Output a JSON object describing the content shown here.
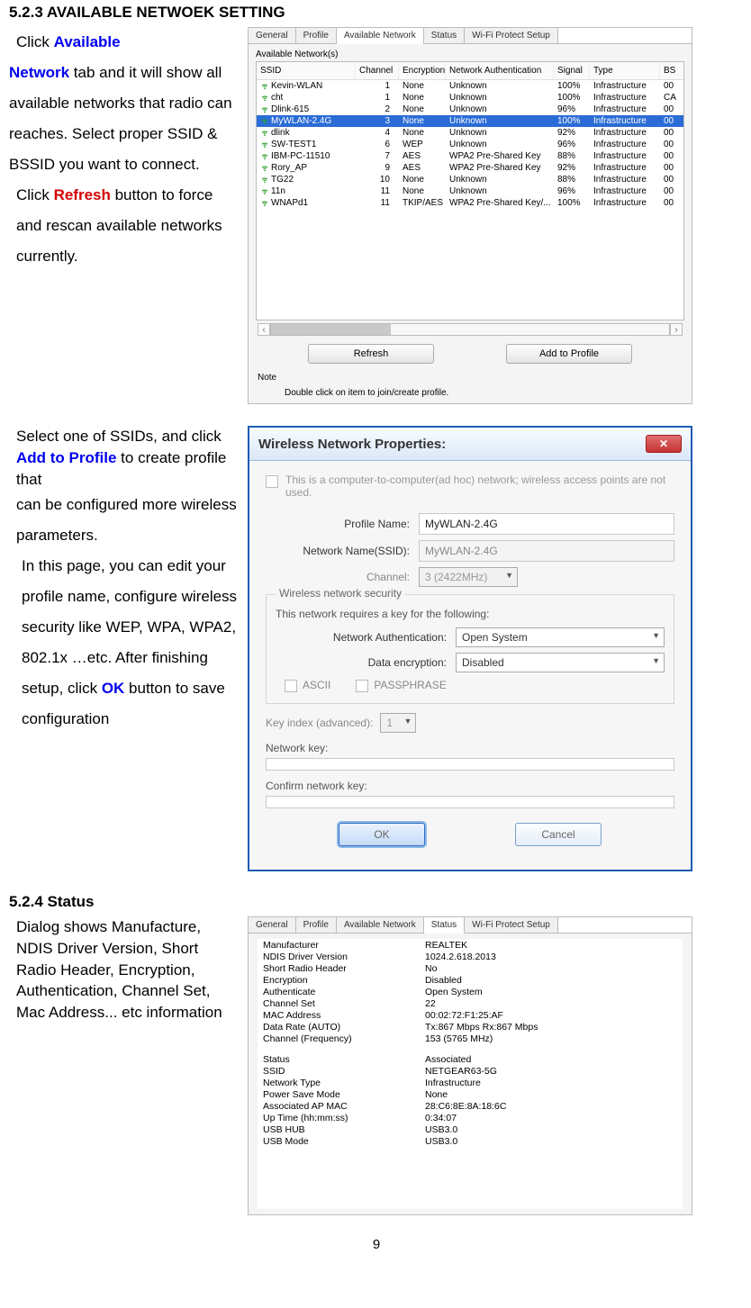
{
  "headings": {
    "s523": "5.2.3 AVAILABLE NETWOEK SETTING",
    "s524": "5.2.4 Status"
  },
  "para_available": {
    "click": "Click ",
    "link1a": "Available",
    "link1b": "Network",
    "p1_rest": " tab and it will show all available networks that radio can reaches. Select proper SSID & BSSID you want to connect.",
    "click2": "Click ",
    "link2": "Refresh",
    "p2_rest": " button to force and rescan available networks currently."
  },
  "para_addprofile": {
    "pre": "Select one of SSIDs, and click ",
    "link": "Add to Profile",
    "mid": " to create profile that",
    "rest1": "can be configured more wireless parameters.",
    "rest2a": "In this page, you can edit your profile name, configure wireless security like WEP, WPA, WPA2, 802.1x …etc. After finishing setup, click ",
    "ok": "OK",
    "rest2b": " button to save configuration"
  },
  "para_status": "Dialog shows Manufacture, NDIS Driver Version, Short Radio Header, Encryption, Authentication, Channel Set, Mac Address... etc information",
  "tabs": [
    "General",
    "Profile",
    "Available Network",
    "Status",
    "Wi-Fi Protect Setup"
  ],
  "screenshot1": {
    "group": "Available Network(s)",
    "columns": [
      "SSID",
      "Channel",
      "Encryption",
      "Network Authentication",
      "Signal",
      "Type",
      "BS"
    ],
    "rows": [
      {
        "ssid": "Kevin-WLAN",
        "ch": "1",
        "enc": "None",
        "auth": "Unknown",
        "sig": "100%",
        "type": "Infrastructure",
        "bs": "00"
      },
      {
        "ssid": "cht",
        "ch": "1",
        "enc": "None",
        "auth": "Unknown",
        "sig": "100%",
        "type": "Infrastructure",
        "bs": "CA"
      },
      {
        "ssid": "Dlink-615",
        "ch": "2",
        "enc": "None",
        "auth": "Unknown",
        "sig": "96%",
        "type": "Infrastructure",
        "bs": "00"
      },
      {
        "ssid": "MyWLAN-2.4G",
        "ch": "3",
        "enc": "None",
        "auth": "Unknown",
        "sig": "100%",
        "type": "Infrastructure",
        "bs": "00",
        "sel": true
      },
      {
        "ssid": "dlink",
        "ch": "4",
        "enc": "None",
        "auth": "Unknown",
        "sig": "92%",
        "type": "Infrastructure",
        "bs": "00"
      },
      {
        "ssid": "SW-TEST1",
        "ch": "6",
        "enc": "WEP",
        "auth": "Unknown",
        "sig": "96%",
        "type": "Infrastructure",
        "bs": "00"
      },
      {
        "ssid": "IBM-PC-11510",
        "ch": "7",
        "enc": "AES",
        "auth": "WPA2 Pre-Shared Key",
        "sig": "88%",
        "type": "Infrastructure",
        "bs": "00"
      },
      {
        "ssid": "Rory_AP",
        "ch": "9",
        "enc": "AES",
        "auth": "WPA2 Pre-Shared Key",
        "sig": "92%",
        "type": "Infrastructure",
        "bs": "00"
      },
      {
        "ssid": "TG22",
        "ch": "10",
        "enc": "None",
        "auth": "Unknown",
        "sig": "88%",
        "type": "Infrastructure",
        "bs": "00"
      },
      {
        "ssid": "11n",
        "ch": "11",
        "enc": "None",
        "auth": "Unknown",
        "sig": "96%",
        "type": "Infrastructure",
        "bs": "00"
      },
      {
        "ssid": "WNAPd1",
        "ch": "11",
        "enc": "TKIP/AES",
        "auth": "WPA2 Pre-Shared Key/...",
        "sig": "100%",
        "type": "Infrastructure",
        "bs": "00"
      }
    ],
    "btn_refresh": "Refresh",
    "btn_add": "Add to Profile",
    "note": "Note",
    "note2": "Double click on item to join/create profile."
  },
  "screenshot2": {
    "title": "Wireless Network Properties:",
    "adhoc": "This is a computer-to-computer(ad hoc) network; wireless access points are not used.",
    "lbl_profile": "Profile Name:",
    "val_profile": "MyWLAN-2.4G",
    "lbl_ssid": "Network Name(SSID):",
    "val_ssid": "MyWLAN-2.4G",
    "lbl_channel": "Channel:",
    "val_channel": "3  (2422MHz)",
    "group_title": "Wireless network security",
    "group_sub": "This network requires a key for the following:",
    "lbl_auth": "Network Authentication:",
    "val_auth": "Open System",
    "lbl_enc": "Data encryption:",
    "val_enc": "Disabled",
    "cb_ascii": "ASCII",
    "cb_pass": "PASSPHRASE",
    "lbl_keyidx": "Key index (advanced):",
    "val_keyidx": "1",
    "lbl_key": "Network key:",
    "lbl_key2": "Confirm network key:",
    "btn_ok": "OK",
    "btn_cancel": "Cancel"
  },
  "screenshot3": {
    "rows": [
      [
        "Manufacturer",
        "REALTEK"
      ],
      [
        "NDIS Driver Version",
        "1024.2.618.2013"
      ],
      [
        "Short Radio Header",
        "No"
      ],
      [
        "Encryption",
        "Disabled"
      ],
      [
        "Authenticate",
        "Open System"
      ],
      [
        "Channel Set",
        "22"
      ],
      [
        "MAC Address",
        "00:02:72:F1:25:AF"
      ],
      [
        "Data Rate (AUTO)",
        "Tx:867 Mbps Rx:867 Mbps"
      ],
      [
        "Channel (Frequency)",
        "153 (5765 MHz)"
      ]
    ],
    "rows2": [
      [
        "Status",
        "Associated"
      ],
      [
        "SSID",
        "NETGEAR63-5G"
      ],
      [
        "Network Type",
        "Infrastructure"
      ],
      [
        "Power Save Mode",
        "None"
      ],
      [
        "Associated AP MAC",
        "28:C6:8E:8A:18:6C"
      ],
      [
        "Up Time (hh:mm:ss)",
        "0:34:07"
      ],
      [
        "USB HUB",
        "USB3.0"
      ],
      [
        "USB Mode",
        "USB3.0"
      ]
    ]
  },
  "page_number": "9"
}
